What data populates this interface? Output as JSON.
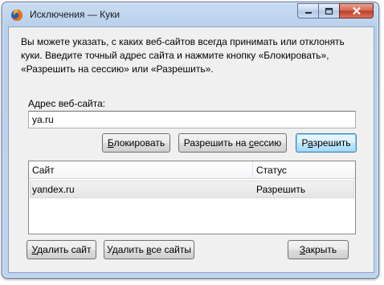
{
  "window": {
    "title": "Исключения — Куки"
  },
  "description": {
    "line1": "Вы можете указать, с каких веб-сайтов всегда принимать или отклонять",
    "line2": "куки. Введите точный адрес сайта и нажмите кнопку «Блокировать»,",
    "line3": "«Разрешить на сессию» или «Разрешить»."
  },
  "url_field": {
    "label": "Адрес веб-сайта:",
    "value": "ya.ru"
  },
  "actions": {
    "block": {
      "pre": "",
      "accel": "Б",
      "post": "локировать"
    },
    "allow_session": {
      "pre": "Разрешить на ",
      "accel": "с",
      "post": "ессию"
    },
    "allow": {
      "pre": "Р",
      "accel": "а",
      "post": "зрешить"
    }
  },
  "table": {
    "columns": [
      "Сайт",
      "Статус"
    ],
    "rows": [
      {
        "site": "yandex.ru",
        "status": "Разрешить"
      }
    ]
  },
  "footer": {
    "remove_site": {
      "pre": "",
      "accel": "У",
      "post": "далить сайт"
    },
    "remove_all": {
      "pre": "Удалить ",
      "accel": "в",
      "post": "се сайты"
    },
    "close": {
      "pre": "",
      "accel": "З",
      "post": "акрыть"
    }
  }
}
